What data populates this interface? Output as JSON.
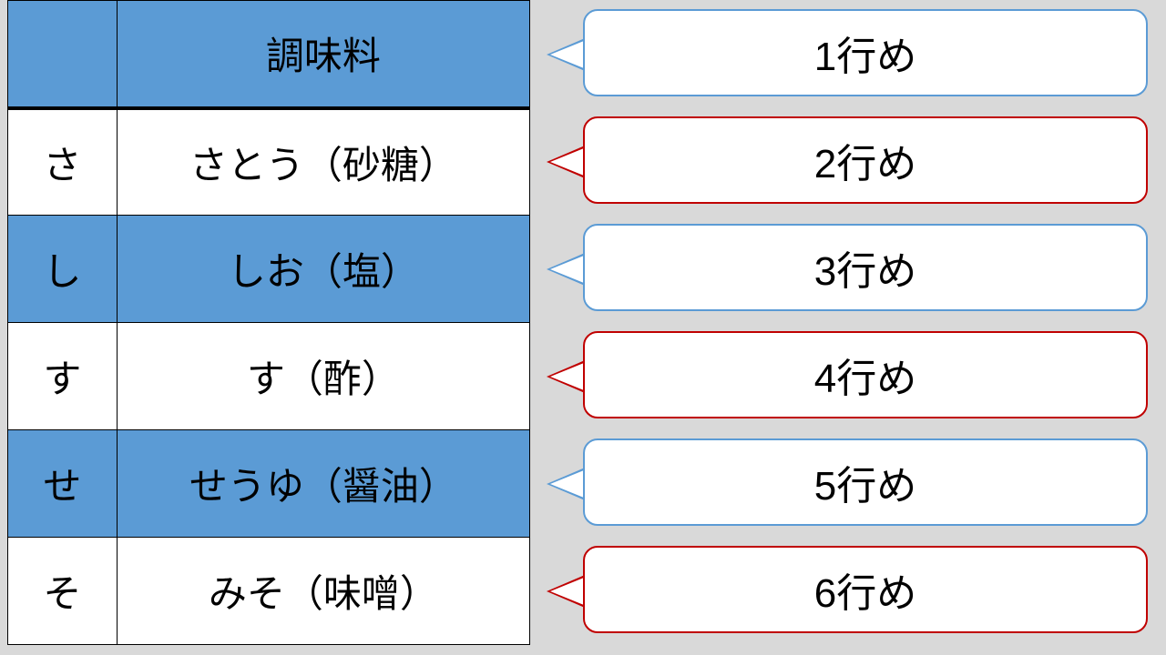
{
  "table": {
    "header": {
      "kana": "",
      "name": "調味料"
    },
    "rows": [
      {
        "kana": "さ",
        "name": "さとう（砂糖）",
        "shade": "white"
      },
      {
        "kana": "し",
        "name": "しお（塩）",
        "shade": "blue"
      },
      {
        "kana": "す",
        "name": "す（酢）",
        "shade": "white"
      },
      {
        "kana": "せ",
        "name": "せうゆ（醤油）",
        "shade": "blue"
      },
      {
        "kana": "そ",
        "name": "みそ（味噌）",
        "shade": "white"
      }
    ]
  },
  "callouts": [
    {
      "label": "1行め",
      "color": "blue"
    },
    {
      "label": "2行め",
      "color": "red"
    },
    {
      "label": "3行め",
      "color": "blue"
    },
    {
      "label": "4行め",
      "color": "red"
    },
    {
      "label": "5行め",
      "color": "blue"
    },
    {
      "label": "6行め",
      "color": "red"
    }
  ]
}
